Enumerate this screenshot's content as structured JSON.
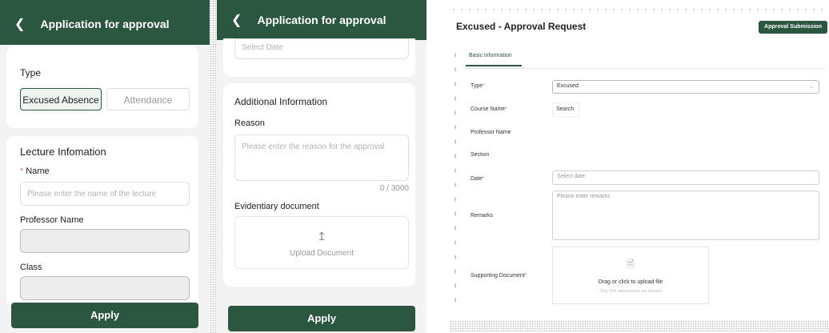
{
  "colors": {
    "brand_green": "#2b5741",
    "required": "#e57373"
  },
  "mobile_form_1": {
    "back_icon": "chevron-left-icon",
    "title": "Application for approval",
    "type_label": "Type",
    "type_options": [
      "Excused Absence",
      "Attendance"
    ],
    "selected_type": "Excused Absence",
    "lecture_section_title": "Lecture Infomation",
    "name_required_mark": "*",
    "name_label": "Name",
    "name_placeholder": "Please enter the name of the lecture",
    "professor_label": "Professor Name",
    "class_label": "Class",
    "apply_label": "Apply"
  },
  "mobile_form_2": {
    "back_icon": "chevron-left-icon",
    "title": "Application for approval",
    "date_placeholder": "Select Date",
    "additional_section_title": "Additional Information",
    "reason_label": "Reason",
    "reason_placeholder": "Please enter the reason for the approval",
    "reason_counter": "0 / 3000",
    "evidence_label": "Evidentiary document",
    "upload_icon": "upload-icon",
    "upload_label": "Upload Document",
    "apply_label": "Apply"
  },
  "desktop_form": {
    "title": "Excused - Approval Request",
    "submit_label": "Approval Submission",
    "tab_label": "Basic information",
    "required_mark": "*",
    "type_label": "Type",
    "type_value": "Excused",
    "course_label": "Course Name",
    "course_search": "Search",
    "professor_label": "Professor Name",
    "section_label": "Section",
    "date_label": "Date",
    "date_placeholder": "Select date",
    "remarks_label": "Remarks",
    "remarks_placeholder": "Please enter remarks",
    "supporting_label": "Supporting Document",
    "upload_icon": "file-upload-icon",
    "upload_text": "Drag or click to upload file",
    "upload_hint": "Only PDF attachments are allowed"
  }
}
